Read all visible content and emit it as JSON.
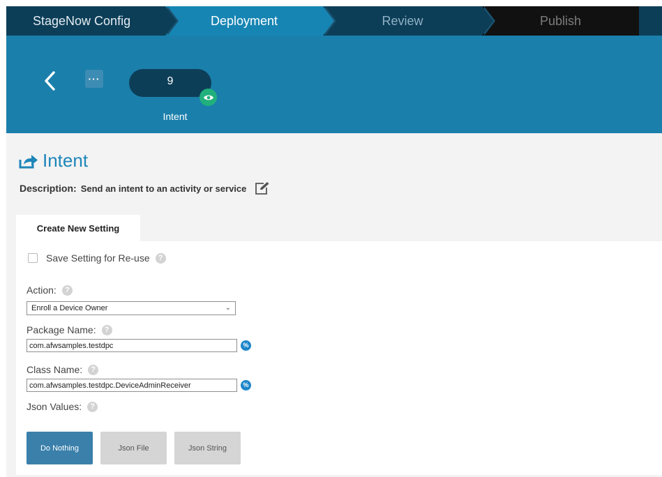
{
  "wizard": {
    "steps": [
      {
        "label": "StageNow Config"
      },
      {
        "label": "Deployment"
      },
      {
        "label": "Review"
      },
      {
        "label": "Publish"
      }
    ]
  },
  "header": {
    "step_number": "9",
    "step_label": "Intent"
  },
  "main": {
    "title": "Intent",
    "description_label": "Description:",
    "description_text": "Send an intent to an activity or service",
    "tab_label": "Create New Setting",
    "save_setting_label": "Save Setting for Re-use",
    "action_label": "Action:",
    "action_value": "Enroll a Device Owner",
    "package_label": "Package Name:",
    "package_value": "com.afwsamples.testdpc",
    "class_label": "Class Name:",
    "class_value": "com.afwsamples.testdpc.DeviceAdminReceiver",
    "json_label": "Json Values:",
    "help_glyph": "?",
    "var_glyph": "%",
    "json_options": [
      "Do Nothing",
      "Json File",
      "Json String"
    ]
  },
  "colors": {
    "accent": "#1785b3",
    "dark_step": "#0d3e58",
    "title_blue": "#1e86b9",
    "badge_green": "#21b07c"
  },
  "icons": {
    "back": "chevron-left-icon",
    "more": "ellipsis-icon",
    "eye": "eye-icon",
    "title": "share-icon",
    "edit": "edit-icon"
  }
}
